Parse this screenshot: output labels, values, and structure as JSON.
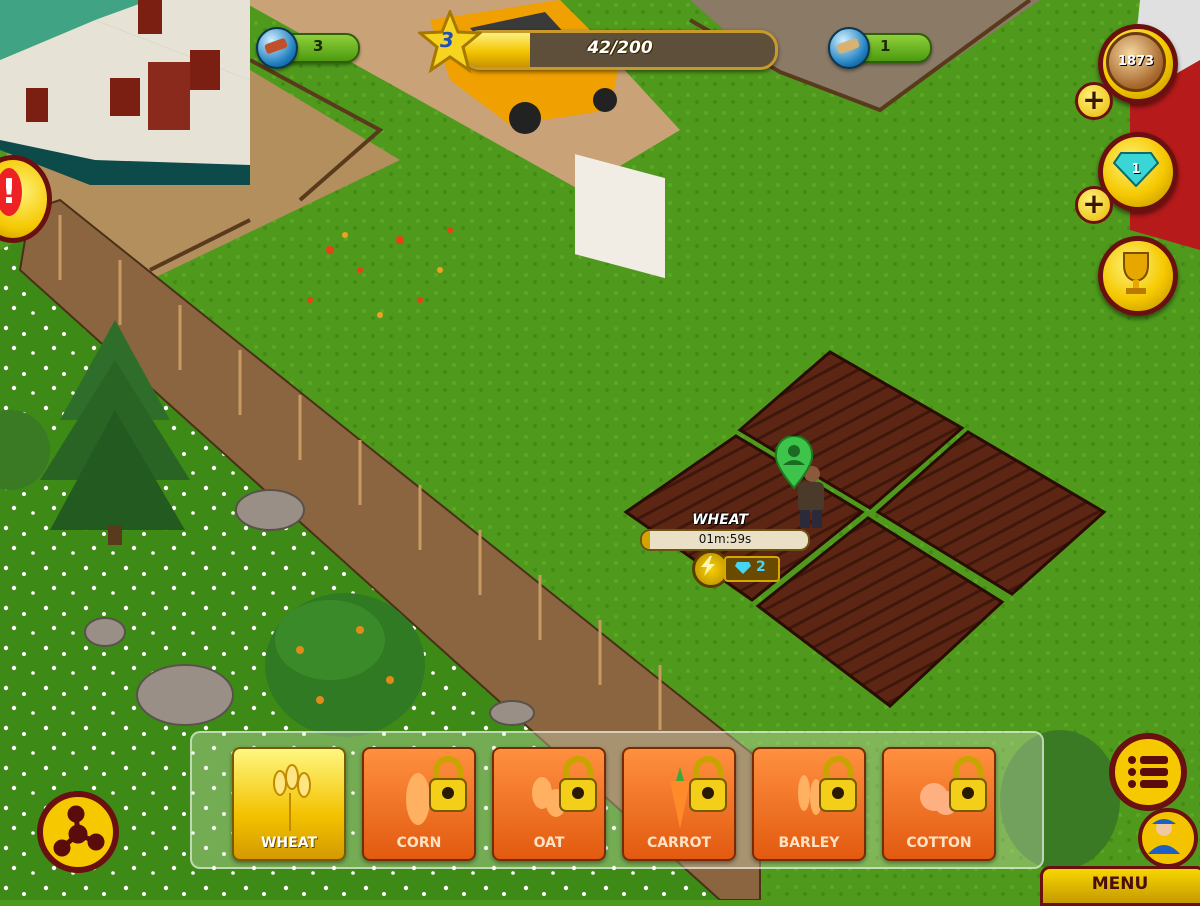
{
  "hud": {
    "bricks_count": "3",
    "level": "3",
    "xp_text": "42/200",
    "xp_progress": 0.21,
    "planks_count": "1",
    "coins": "1873",
    "gems": "1"
  },
  "field": {
    "crop_name": "WHEAT",
    "timer": "01m:59s",
    "timer_progress": 0.05,
    "gem_cost": "2"
  },
  "crops": [
    {
      "label": "WHEAT",
      "locked": false,
      "icon": "wheat-icon"
    },
    {
      "label": "CORN",
      "locked": true,
      "icon": "corn-icon"
    },
    {
      "label": "OAT",
      "locked": true,
      "icon": "oat-icon"
    },
    {
      "label": "CARROT",
      "locked": true,
      "icon": "carrot-icon"
    },
    {
      "label": "BARLEY",
      "locked": true,
      "icon": "barley-icon"
    },
    {
      "label": "COTTON",
      "locked": true,
      "icon": "cotton-icon"
    }
  ],
  "menu": {
    "label": "MENU"
  },
  "colors": {
    "grass": "#4f9a1c",
    "soil": "#5a2312",
    "accent": "#f5c800",
    "frame": "#6b1010"
  }
}
